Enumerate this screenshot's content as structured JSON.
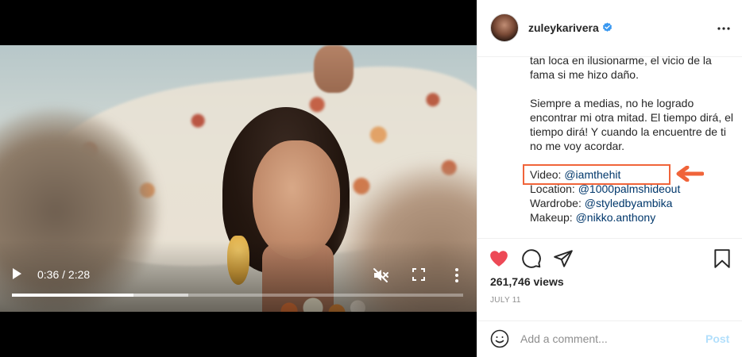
{
  "video": {
    "time_display": "0:36 / 2:28",
    "played_fraction": 0.27,
    "buffered_fraction": 0.39,
    "controls": {
      "play_icon": "play-icon",
      "mute_icon": "muted-speaker-icon",
      "fullscreen_icon": "fullscreen-icon",
      "more_icon": "vertical-ellipsis-icon"
    }
  },
  "post": {
    "username": "zuleykarivera",
    "verified": true,
    "caption": {
      "paragraph1": "tan loca en ilusionarme, el vicio de la fama si me hizo daño.",
      "paragraph2": "Siempre a medias, no he logrado encontrar mi otra mitad. El tiempo dirá, el tiempo dirá! Y cuando la encuentre de ti no me voy acordar.",
      "credits": [
        {
          "label": "Video: ",
          "mention": "@iamthehit"
        },
        {
          "label": "Location: ",
          "mention": "@1000palmshideout"
        },
        {
          "label": "Wardrobe: ",
          "mention": "@styledbyambika"
        },
        {
          "label": "Makeup: ",
          "mention": "@nikko.anthony"
        }
      ]
    },
    "views": "261,746 views",
    "date": "JULY 11",
    "liked": true
  },
  "comment": {
    "placeholder": "Add a comment...",
    "post_label": "Post"
  },
  "colors": {
    "like_red": "#ed4956",
    "mention_blue": "#00376b",
    "verified_blue": "#3897f0",
    "highlight_orange": "#f0643a",
    "post_disabled": "#b2dffc"
  }
}
